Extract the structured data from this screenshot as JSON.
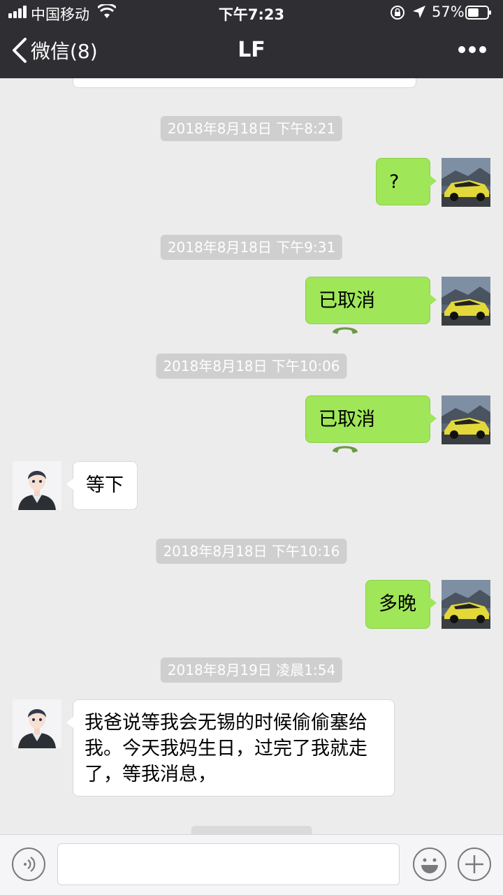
{
  "status_bar": {
    "carrier": "中国移动",
    "time": "下午7:23",
    "battery_percent": "57%",
    "battery_level": 0.57
  },
  "nav": {
    "back_label": "微信(8)",
    "title": "LF"
  },
  "messages": [
    {
      "type": "time",
      "text": "2018年8月18日 下午8:21"
    },
    {
      "type": "me",
      "text": "?"
    },
    {
      "type": "time",
      "text": "2018年8月18日 下午9:31"
    },
    {
      "type": "me-call",
      "text": "已取消"
    },
    {
      "type": "time",
      "text": "2018年8月18日 下午10:06"
    },
    {
      "type": "me-call",
      "text": "已取消"
    },
    {
      "type": "them",
      "text": "等下"
    },
    {
      "type": "time",
      "text": "2018年8月18日 下午10:16"
    },
    {
      "type": "me",
      "text": "多晚"
    },
    {
      "type": "time",
      "text": "2018年8月19日 凌晨1:54"
    },
    {
      "type": "them",
      "text": "我爸说等我会无锡的时候偷偷塞给我。今天我妈生日，过完了我就走了，等我消息，"
    }
  ],
  "colors": {
    "header_bg": "#2f2f33",
    "chat_bg": "#ececec",
    "my_bubble": "#9fe658",
    "their_bubble": "#ffffff",
    "time_chip": "#cfcfcf"
  }
}
